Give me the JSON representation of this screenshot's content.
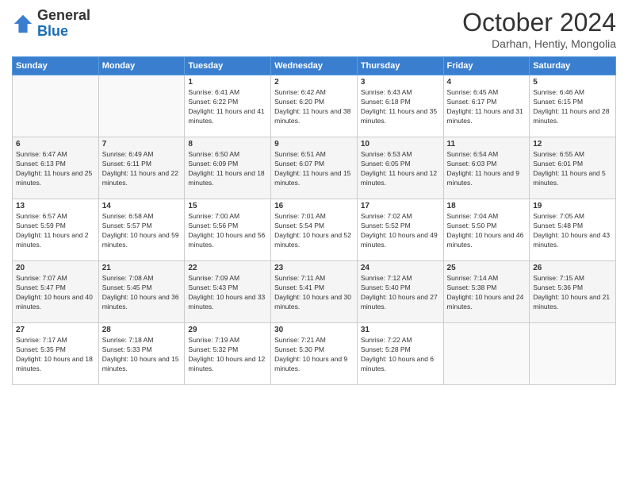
{
  "header": {
    "logo_general": "General",
    "logo_blue": "Blue",
    "month_title": "October 2024",
    "subtitle": "Darhan, Hentiy, Mongolia"
  },
  "days_of_week": [
    "Sunday",
    "Monday",
    "Tuesday",
    "Wednesday",
    "Thursday",
    "Friday",
    "Saturday"
  ],
  "weeks": [
    [
      {
        "day": "",
        "info": ""
      },
      {
        "day": "",
        "info": ""
      },
      {
        "day": "1",
        "sunrise": "Sunrise: 6:41 AM",
        "sunset": "Sunset: 6:22 PM",
        "daylight": "Daylight: 11 hours and 41 minutes."
      },
      {
        "day": "2",
        "sunrise": "Sunrise: 6:42 AM",
        "sunset": "Sunset: 6:20 PM",
        "daylight": "Daylight: 11 hours and 38 minutes."
      },
      {
        "day": "3",
        "sunrise": "Sunrise: 6:43 AM",
        "sunset": "Sunset: 6:18 PM",
        "daylight": "Daylight: 11 hours and 35 minutes."
      },
      {
        "day": "4",
        "sunrise": "Sunrise: 6:45 AM",
        "sunset": "Sunset: 6:17 PM",
        "daylight": "Daylight: 11 hours and 31 minutes."
      },
      {
        "day": "5",
        "sunrise": "Sunrise: 6:46 AM",
        "sunset": "Sunset: 6:15 PM",
        "daylight": "Daylight: 11 hours and 28 minutes."
      }
    ],
    [
      {
        "day": "6",
        "sunrise": "Sunrise: 6:47 AM",
        "sunset": "Sunset: 6:13 PM",
        "daylight": "Daylight: 11 hours and 25 minutes."
      },
      {
        "day": "7",
        "sunrise": "Sunrise: 6:49 AM",
        "sunset": "Sunset: 6:11 PM",
        "daylight": "Daylight: 11 hours and 22 minutes."
      },
      {
        "day": "8",
        "sunrise": "Sunrise: 6:50 AM",
        "sunset": "Sunset: 6:09 PM",
        "daylight": "Daylight: 11 hours and 18 minutes."
      },
      {
        "day": "9",
        "sunrise": "Sunrise: 6:51 AM",
        "sunset": "Sunset: 6:07 PM",
        "daylight": "Daylight: 11 hours and 15 minutes."
      },
      {
        "day": "10",
        "sunrise": "Sunrise: 6:53 AM",
        "sunset": "Sunset: 6:05 PM",
        "daylight": "Daylight: 11 hours and 12 minutes."
      },
      {
        "day": "11",
        "sunrise": "Sunrise: 6:54 AM",
        "sunset": "Sunset: 6:03 PM",
        "daylight": "Daylight: 11 hours and 9 minutes."
      },
      {
        "day": "12",
        "sunrise": "Sunrise: 6:55 AM",
        "sunset": "Sunset: 6:01 PM",
        "daylight": "Daylight: 11 hours and 5 minutes."
      }
    ],
    [
      {
        "day": "13",
        "sunrise": "Sunrise: 6:57 AM",
        "sunset": "Sunset: 5:59 PM",
        "daylight": "Daylight: 11 hours and 2 minutes."
      },
      {
        "day": "14",
        "sunrise": "Sunrise: 6:58 AM",
        "sunset": "Sunset: 5:57 PM",
        "daylight": "Daylight: 10 hours and 59 minutes."
      },
      {
        "day": "15",
        "sunrise": "Sunrise: 7:00 AM",
        "sunset": "Sunset: 5:56 PM",
        "daylight": "Daylight: 10 hours and 56 minutes."
      },
      {
        "day": "16",
        "sunrise": "Sunrise: 7:01 AM",
        "sunset": "Sunset: 5:54 PM",
        "daylight": "Daylight: 10 hours and 52 minutes."
      },
      {
        "day": "17",
        "sunrise": "Sunrise: 7:02 AM",
        "sunset": "Sunset: 5:52 PM",
        "daylight": "Daylight: 10 hours and 49 minutes."
      },
      {
        "day": "18",
        "sunrise": "Sunrise: 7:04 AM",
        "sunset": "Sunset: 5:50 PM",
        "daylight": "Daylight: 10 hours and 46 minutes."
      },
      {
        "day": "19",
        "sunrise": "Sunrise: 7:05 AM",
        "sunset": "Sunset: 5:48 PM",
        "daylight": "Daylight: 10 hours and 43 minutes."
      }
    ],
    [
      {
        "day": "20",
        "sunrise": "Sunrise: 7:07 AM",
        "sunset": "Sunset: 5:47 PM",
        "daylight": "Daylight: 10 hours and 40 minutes."
      },
      {
        "day": "21",
        "sunrise": "Sunrise: 7:08 AM",
        "sunset": "Sunset: 5:45 PM",
        "daylight": "Daylight: 10 hours and 36 minutes."
      },
      {
        "day": "22",
        "sunrise": "Sunrise: 7:09 AM",
        "sunset": "Sunset: 5:43 PM",
        "daylight": "Daylight: 10 hours and 33 minutes."
      },
      {
        "day": "23",
        "sunrise": "Sunrise: 7:11 AM",
        "sunset": "Sunset: 5:41 PM",
        "daylight": "Daylight: 10 hours and 30 minutes."
      },
      {
        "day": "24",
        "sunrise": "Sunrise: 7:12 AM",
        "sunset": "Sunset: 5:40 PM",
        "daylight": "Daylight: 10 hours and 27 minutes."
      },
      {
        "day": "25",
        "sunrise": "Sunrise: 7:14 AM",
        "sunset": "Sunset: 5:38 PM",
        "daylight": "Daylight: 10 hours and 24 minutes."
      },
      {
        "day": "26",
        "sunrise": "Sunrise: 7:15 AM",
        "sunset": "Sunset: 5:36 PM",
        "daylight": "Daylight: 10 hours and 21 minutes."
      }
    ],
    [
      {
        "day": "27",
        "sunrise": "Sunrise: 7:17 AM",
        "sunset": "Sunset: 5:35 PM",
        "daylight": "Daylight: 10 hours and 18 minutes."
      },
      {
        "day": "28",
        "sunrise": "Sunrise: 7:18 AM",
        "sunset": "Sunset: 5:33 PM",
        "daylight": "Daylight: 10 hours and 15 minutes."
      },
      {
        "day": "29",
        "sunrise": "Sunrise: 7:19 AM",
        "sunset": "Sunset: 5:32 PM",
        "daylight": "Daylight: 10 hours and 12 minutes."
      },
      {
        "day": "30",
        "sunrise": "Sunrise: 7:21 AM",
        "sunset": "Sunset: 5:30 PM",
        "daylight": "Daylight: 10 hours and 9 minutes."
      },
      {
        "day": "31",
        "sunrise": "Sunrise: 7:22 AM",
        "sunset": "Sunset: 5:28 PM",
        "daylight": "Daylight: 10 hours and 6 minutes."
      },
      {
        "day": "",
        "info": ""
      },
      {
        "day": "",
        "info": ""
      }
    ]
  ]
}
